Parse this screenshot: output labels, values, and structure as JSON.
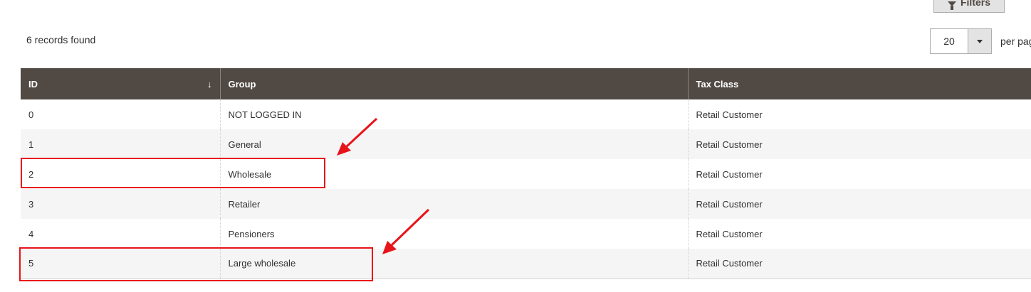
{
  "toolbar": {
    "filters_label": "Filters",
    "records_found": "6 records found",
    "per_page_value": "20",
    "per_page_label": "per page"
  },
  "grid": {
    "columns": [
      {
        "label": "ID",
        "sort_indicator": "↓"
      },
      {
        "label": "Group"
      },
      {
        "label": "Tax Class"
      }
    ],
    "rows": [
      {
        "id": "0",
        "group": "NOT LOGGED IN",
        "tax_class": "Retail Customer"
      },
      {
        "id": "1",
        "group": "General",
        "tax_class": "Retail Customer"
      },
      {
        "id": "2",
        "group": "Wholesale",
        "tax_class": "Retail Customer"
      },
      {
        "id": "3",
        "group": "Retailer",
        "tax_class": "Retail Customer"
      },
      {
        "id": "4",
        "group": "Pensioners",
        "tax_class": "Retail Customer"
      },
      {
        "id": "5",
        "group": "Large wholesale",
        "tax_class": "Retail Customer"
      }
    ]
  },
  "annotations": {
    "highlight_color": "#e8141b",
    "highlighted_rows": [
      "2",
      "5"
    ]
  },
  "colors": {
    "header_bg": "#514943",
    "stripe_bg": "#f5f5f5",
    "button_bg": "#e3e3e3"
  },
  "icons": [
    "funnel-icon",
    "caret-down-icon",
    "sort-desc-icon",
    "arrow-annotation-icon"
  ]
}
